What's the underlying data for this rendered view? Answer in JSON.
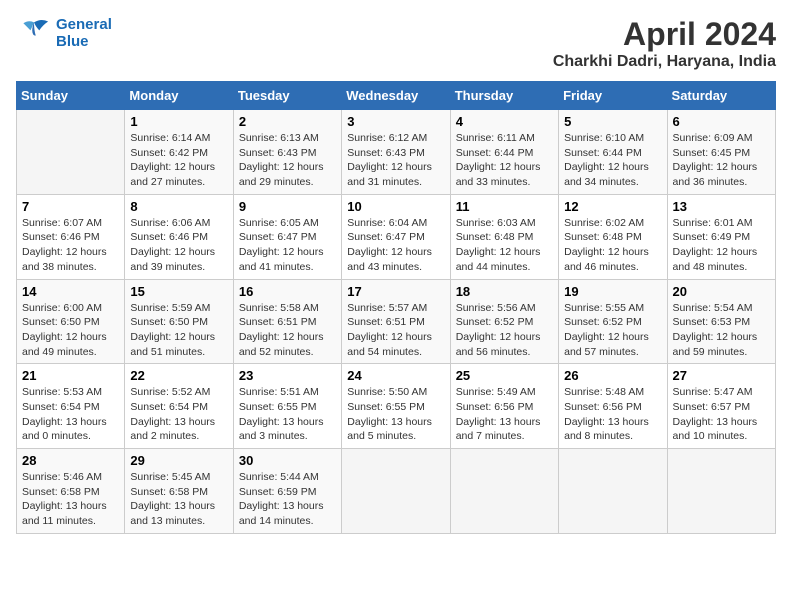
{
  "header": {
    "logo_line1": "General",
    "logo_line2": "Blue",
    "title": "April 2024",
    "location": "Charkhi Dadri, Haryana, India"
  },
  "weekdays": [
    "Sunday",
    "Monday",
    "Tuesday",
    "Wednesday",
    "Thursday",
    "Friday",
    "Saturday"
  ],
  "weeks": [
    [
      {
        "day": "",
        "info": ""
      },
      {
        "day": "1",
        "info": "Sunrise: 6:14 AM\nSunset: 6:42 PM\nDaylight: 12 hours\nand 27 minutes."
      },
      {
        "day": "2",
        "info": "Sunrise: 6:13 AM\nSunset: 6:43 PM\nDaylight: 12 hours\nand 29 minutes."
      },
      {
        "day": "3",
        "info": "Sunrise: 6:12 AM\nSunset: 6:43 PM\nDaylight: 12 hours\nand 31 minutes."
      },
      {
        "day": "4",
        "info": "Sunrise: 6:11 AM\nSunset: 6:44 PM\nDaylight: 12 hours\nand 33 minutes."
      },
      {
        "day": "5",
        "info": "Sunrise: 6:10 AM\nSunset: 6:44 PM\nDaylight: 12 hours\nand 34 minutes."
      },
      {
        "day": "6",
        "info": "Sunrise: 6:09 AM\nSunset: 6:45 PM\nDaylight: 12 hours\nand 36 minutes."
      }
    ],
    [
      {
        "day": "7",
        "info": "Sunrise: 6:07 AM\nSunset: 6:46 PM\nDaylight: 12 hours\nand 38 minutes."
      },
      {
        "day": "8",
        "info": "Sunrise: 6:06 AM\nSunset: 6:46 PM\nDaylight: 12 hours\nand 39 minutes."
      },
      {
        "day": "9",
        "info": "Sunrise: 6:05 AM\nSunset: 6:47 PM\nDaylight: 12 hours\nand 41 minutes."
      },
      {
        "day": "10",
        "info": "Sunrise: 6:04 AM\nSunset: 6:47 PM\nDaylight: 12 hours\nand 43 minutes."
      },
      {
        "day": "11",
        "info": "Sunrise: 6:03 AM\nSunset: 6:48 PM\nDaylight: 12 hours\nand 44 minutes."
      },
      {
        "day": "12",
        "info": "Sunrise: 6:02 AM\nSunset: 6:48 PM\nDaylight: 12 hours\nand 46 minutes."
      },
      {
        "day": "13",
        "info": "Sunrise: 6:01 AM\nSunset: 6:49 PM\nDaylight: 12 hours\nand 48 minutes."
      }
    ],
    [
      {
        "day": "14",
        "info": "Sunrise: 6:00 AM\nSunset: 6:50 PM\nDaylight: 12 hours\nand 49 minutes."
      },
      {
        "day": "15",
        "info": "Sunrise: 5:59 AM\nSunset: 6:50 PM\nDaylight: 12 hours\nand 51 minutes."
      },
      {
        "day": "16",
        "info": "Sunrise: 5:58 AM\nSunset: 6:51 PM\nDaylight: 12 hours\nand 52 minutes."
      },
      {
        "day": "17",
        "info": "Sunrise: 5:57 AM\nSunset: 6:51 PM\nDaylight: 12 hours\nand 54 minutes."
      },
      {
        "day": "18",
        "info": "Sunrise: 5:56 AM\nSunset: 6:52 PM\nDaylight: 12 hours\nand 56 minutes."
      },
      {
        "day": "19",
        "info": "Sunrise: 5:55 AM\nSunset: 6:52 PM\nDaylight: 12 hours\nand 57 minutes."
      },
      {
        "day": "20",
        "info": "Sunrise: 5:54 AM\nSunset: 6:53 PM\nDaylight: 12 hours\nand 59 minutes."
      }
    ],
    [
      {
        "day": "21",
        "info": "Sunrise: 5:53 AM\nSunset: 6:54 PM\nDaylight: 13 hours\nand 0 minutes."
      },
      {
        "day": "22",
        "info": "Sunrise: 5:52 AM\nSunset: 6:54 PM\nDaylight: 13 hours\nand 2 minutes."
      },
      {
        "day": "23",
        "info": "Sunrise: 5:51 AM\nSunset: 6:55 PM\nDaylight: 13 hours\nand 3 minutes."
      },
      {
        "day": "24",
        "info": "Sunrise: 5:50 AM\nSunset: 6:55 PM\nDaylight: 13 hours\nand 5 minutes."
      },
      {
        "day": "25",
        "info": "Sunrise: 5:49 AM\nSunset: 6:56 PM\nDaylight: 13 hours\nand 7 minutes."
      },
      {
        "day": "26",
        "info": "Sunrise: 5:48 AM\nSunset: 6:56 PM\nDaylight: 13 hours\nand 8 minutes."
      },
      {
        "day": "27",
        "info": "Sunrise: 5:47 AM\nSunset: 6:57 PM\nDaylight: 13 hours\nand 10 minutes."
      }
    ],
    [
      {
        "day": "28",
        "info": "Sunrise: 5:46 AM\nSunset: 6:58 PM\nDaylight: 13 hours\nand 11 minutes."
      },
      {
        "day": "29",
        "info": "Sunrise: 5:45 AM\nSunset: 6:58 PM\nDaylight: 13 hours\nand 13 minutes."
      },
      {
        "day": "30",
        "info": "Sunrise: 5:44 AM\nSunset: 6:59 PM\nDaylight: 13 hours\nand 14 minutes."
      },
      {
        "day": "",
        "info": ""
      },
      {
        "day": "",
        "info": ""
      },
      {
        "day": "",
        "info": ""
      },
      {
        "day": "",
        "info": ""
      }
    ]
  ]
}
